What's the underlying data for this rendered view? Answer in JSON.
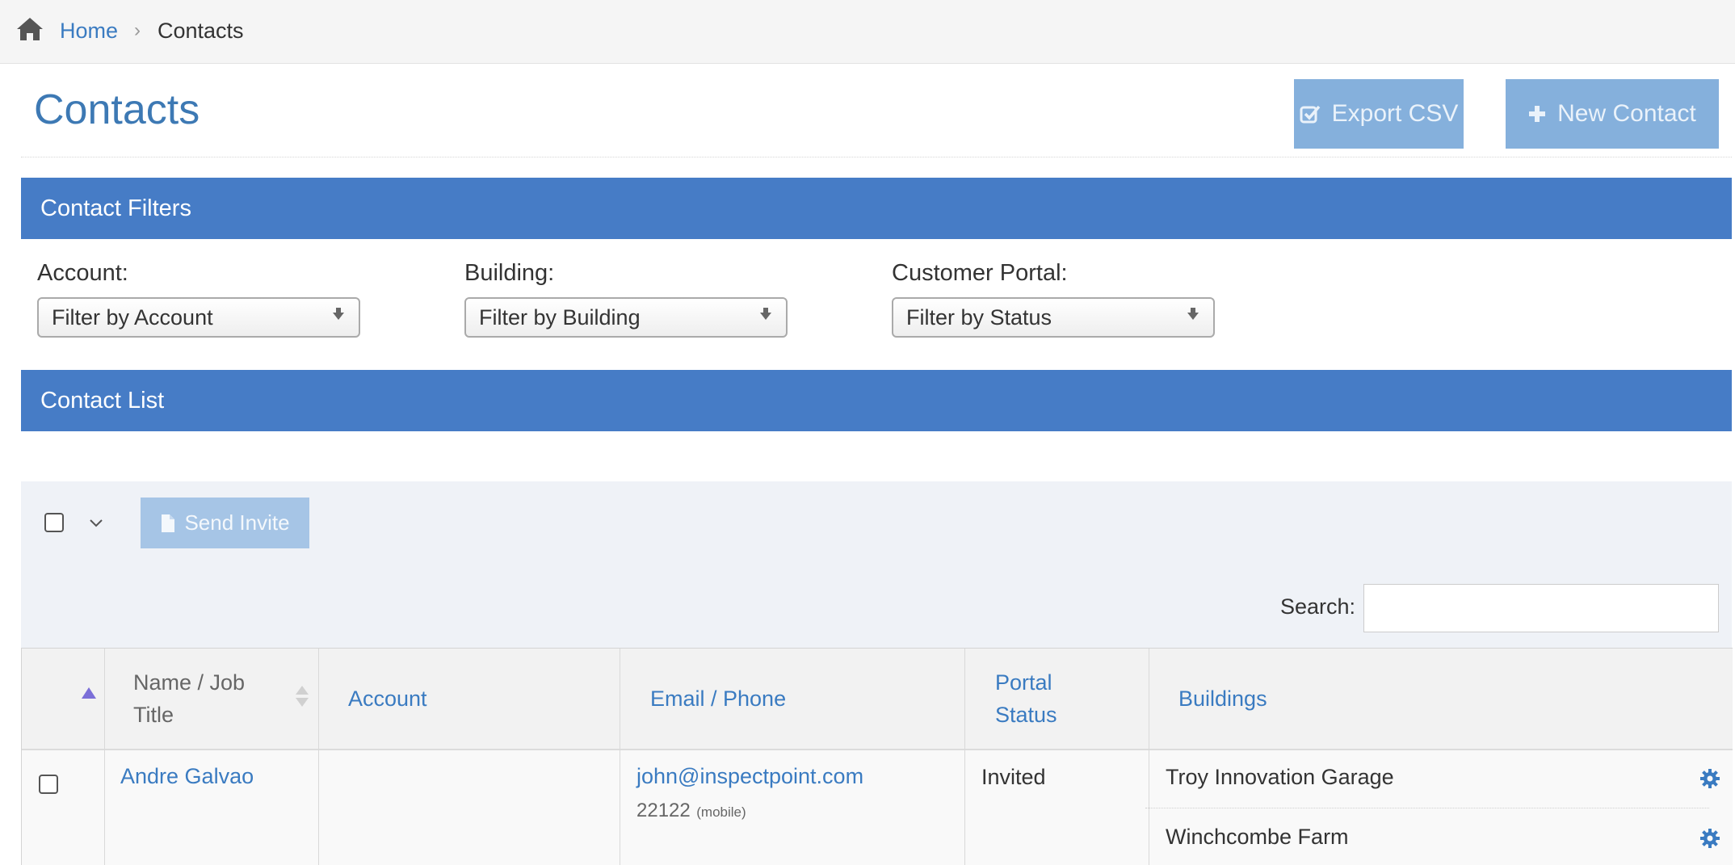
{
  "breadcrumb": {
    "home": "Home",
    "separator": "›",
    "current": "Contacts"
  },
  "page": {
    "title": "Contacts",
    "export_label": "Export CSV",
    "new_label": "New Contact"
  },
  "filters": {
    "header": "Contact Filters",
    "account": {
      "label": "Account:",
      "value": "Filter by Account"
    },
    "building": {
      "label": "Building:",
      "value": "Filter by Building"
    },
    "portal": {
      "label": "Customer Portal:",
      "value": "Filter by Status"
    }
  },
  "list": {
    "header": "Contact List",
    "send_invite": "Send Invite",
    "search_label": "Search:",
    "search_value": "",
    "columns": {
      "name_line1": "Name / Job",
      "name_line2": "Title",
      "account": "Account",
      "email": "Email / Phone",
      "portal_line1": "Portal",
      "portal_line2": "Status",
      "buildings": "Buildings"
    },
    "rows": [
      {
        "name": "Andre Galvao",
        "account": "",
        "email": "john@inspectpoint.com",
        "phone": "22122",
        "phone_type": "(mobile)",
        "status": "Invited",
        "buildings": [
          "Troy Innovation Garage",
          "Winchcombe Farm"
        ]
      }
    ]
  },
  "colors": {
    "accent": "#467cc6",
    "link": "#3a7bc1",
    "button": "#85b0dc",
    "panel_bg": "#eff2f7"
  },
  "icons": [
    "home-icon",
    "checkbox-icon",
    "plus-icon",
    "file-icon",
    "chevron-down-icon",
    "sort-icon",
    "gear-icon"
  ]
}
